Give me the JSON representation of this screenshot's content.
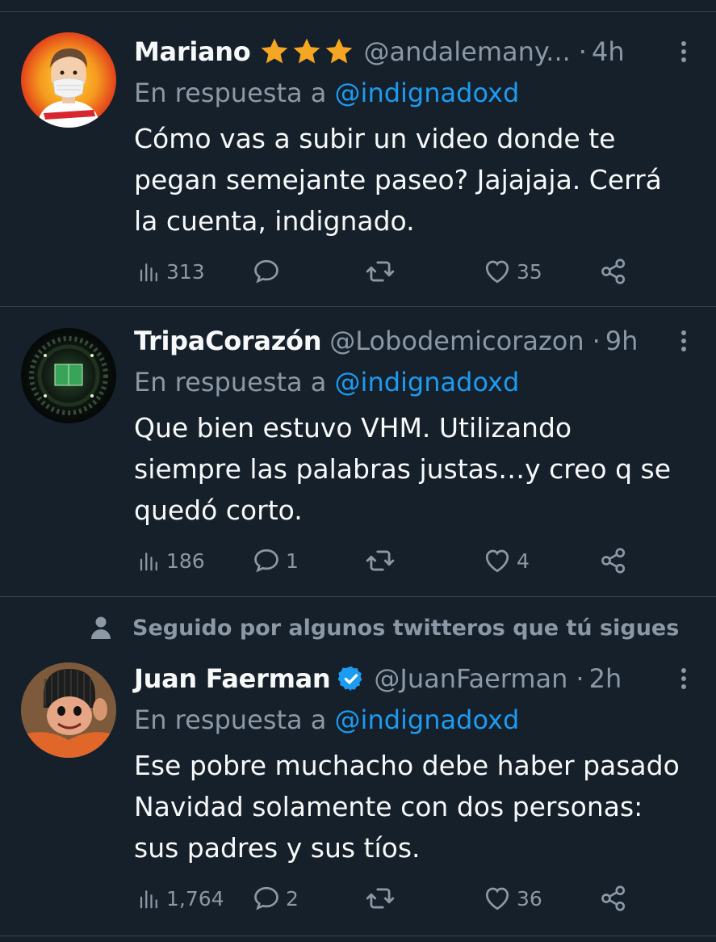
{
  "social_context": "Seguido por algunos twitteros que tú sigues",
  "tweets": [
    {
      "name": "Mariano",
      "handle": "@andalemany...",
      "time": "4h",
      "reply_prefix": "En respuesta a",
      "reply_mention": "@indignadoxd",
      "text": "Cómo vas a subir un video donde te\npegan semejante paseo? Jajajaja. Cerrá\nla cuenta, indignado.",
      "views": "313",
      "replies": "",
      "retweets": "",
      "likes": "35"
    },
    {
      "name": "TripaCorazón",
      "handle": "@Lobodemicorazon",
      "time": "9h",
      "reply_prefix": "En respuesta a",
      "reply_mention": "@indignadoxd",
      "text": "Que bien estuvo VHM. Utilizando\nsiempre las palabras justas…y creo q se\nquedó corto.",
      "views": "186",
      "replies": "1",
      "retweets": "",
      "likes": "4"
    },
    {
      "name": "Juan Faerman",
      "handle": "@JuanFaerman",
      "time": "2h",
      "reply_prefix": "En respuesta a",
      "reply_mention": "@indignadoxd",
      "text": "Ese pobre muchacho debe haber pasado\nNavidad solamente con dos personas:\nsus padres y sus tíos.",
      "views": "1,764",
      "replies": "2",
      "retweets": "",
      "likes": "36"
    }
  ],
  "colors": {
    "background": "#15202b",
    "text": "#f7f9f9",
    "secondary": "#8b98a5",
    "link": "#1d9bf0",
    "star": "#f5a623",
    "divider": "#38444d"
  }
}
